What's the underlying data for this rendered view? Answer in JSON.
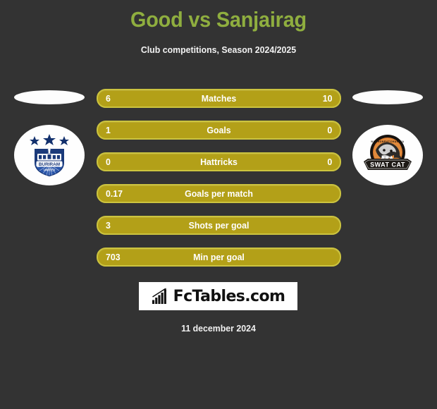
{
  "header": {
    "title": "Good vs Sanjairag",
    "subtitle": "Club competitions, Season 2024/2025",
    "title_color": "#8fae3f"
  },
  "theme": {
    "background": "#333333",
    "bar_fill": "#b3a018",
    "bar_border": "#ccc43f",
    "text_color": "#ffffff"
  },
  "teams": {
    "home": {
      "name": "Buriram United",
      "logo_icon": "buriram-united-crest",
      "crest_colors": {
        "shield": "#1b3a7a",
        "accent": "#ffffff"
      }
    },
    "away": {
      "name": "Swat Cat",
      "logo_icon": "swat-cat-crest",
      "crest_colors": {
        "ring": "#1a1a1a",
        "accent": "#e2761b"
      }
    }
  },
  "stats": [
    {
      "label": "Matches",
      "home": "6",
      "away": "10"
    },
    {
      "label": "Goals",
      "home": "1",
      "away": "0"
    },
    {
      "label": "Hattricks",
      "home": "0",
      "away": "0"
    },
    {
      "label": "Goals per match",
      "home": "0.17",
      "away": ""
    },
    {
      "label": "Shots per goal",
      "home": "3",
      "away": ""
    },
    {
      "label": "Min per goal",
      "home": "703",
      "away": ""
    }
  ],
  "brand": {
    "text": "FcTables.com",
    "icon": "bar-chart-growth-icon"
  },
  "footer": {
    "date": "11 december 2024"
  }
}
